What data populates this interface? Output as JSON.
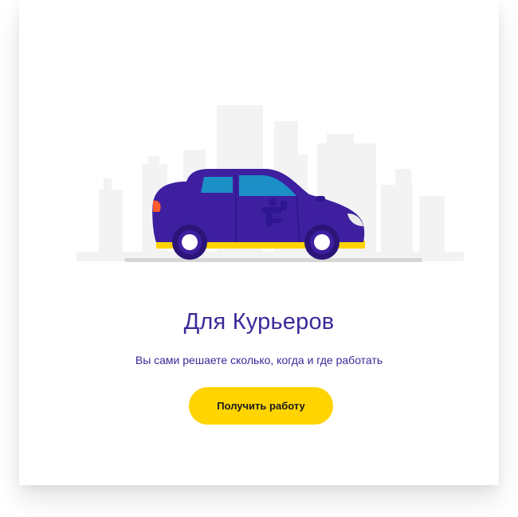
{
  "hero": {
    "title": "Для Курьеров",
    "subtitle": "Вы сами решаете сколько, когда и где работать",
    "cta_label": "Получить работу"
  },
  "colors": {
    "brand_purple": "#3a2a9a",
    "car_body": "#3d1fa0",
    "accent_yellow": "#ffd400",
    "city_gray": "#f2f2f2"
  },
  "icons": {
    "illustration": "courier-car-illustration"
  }
}
